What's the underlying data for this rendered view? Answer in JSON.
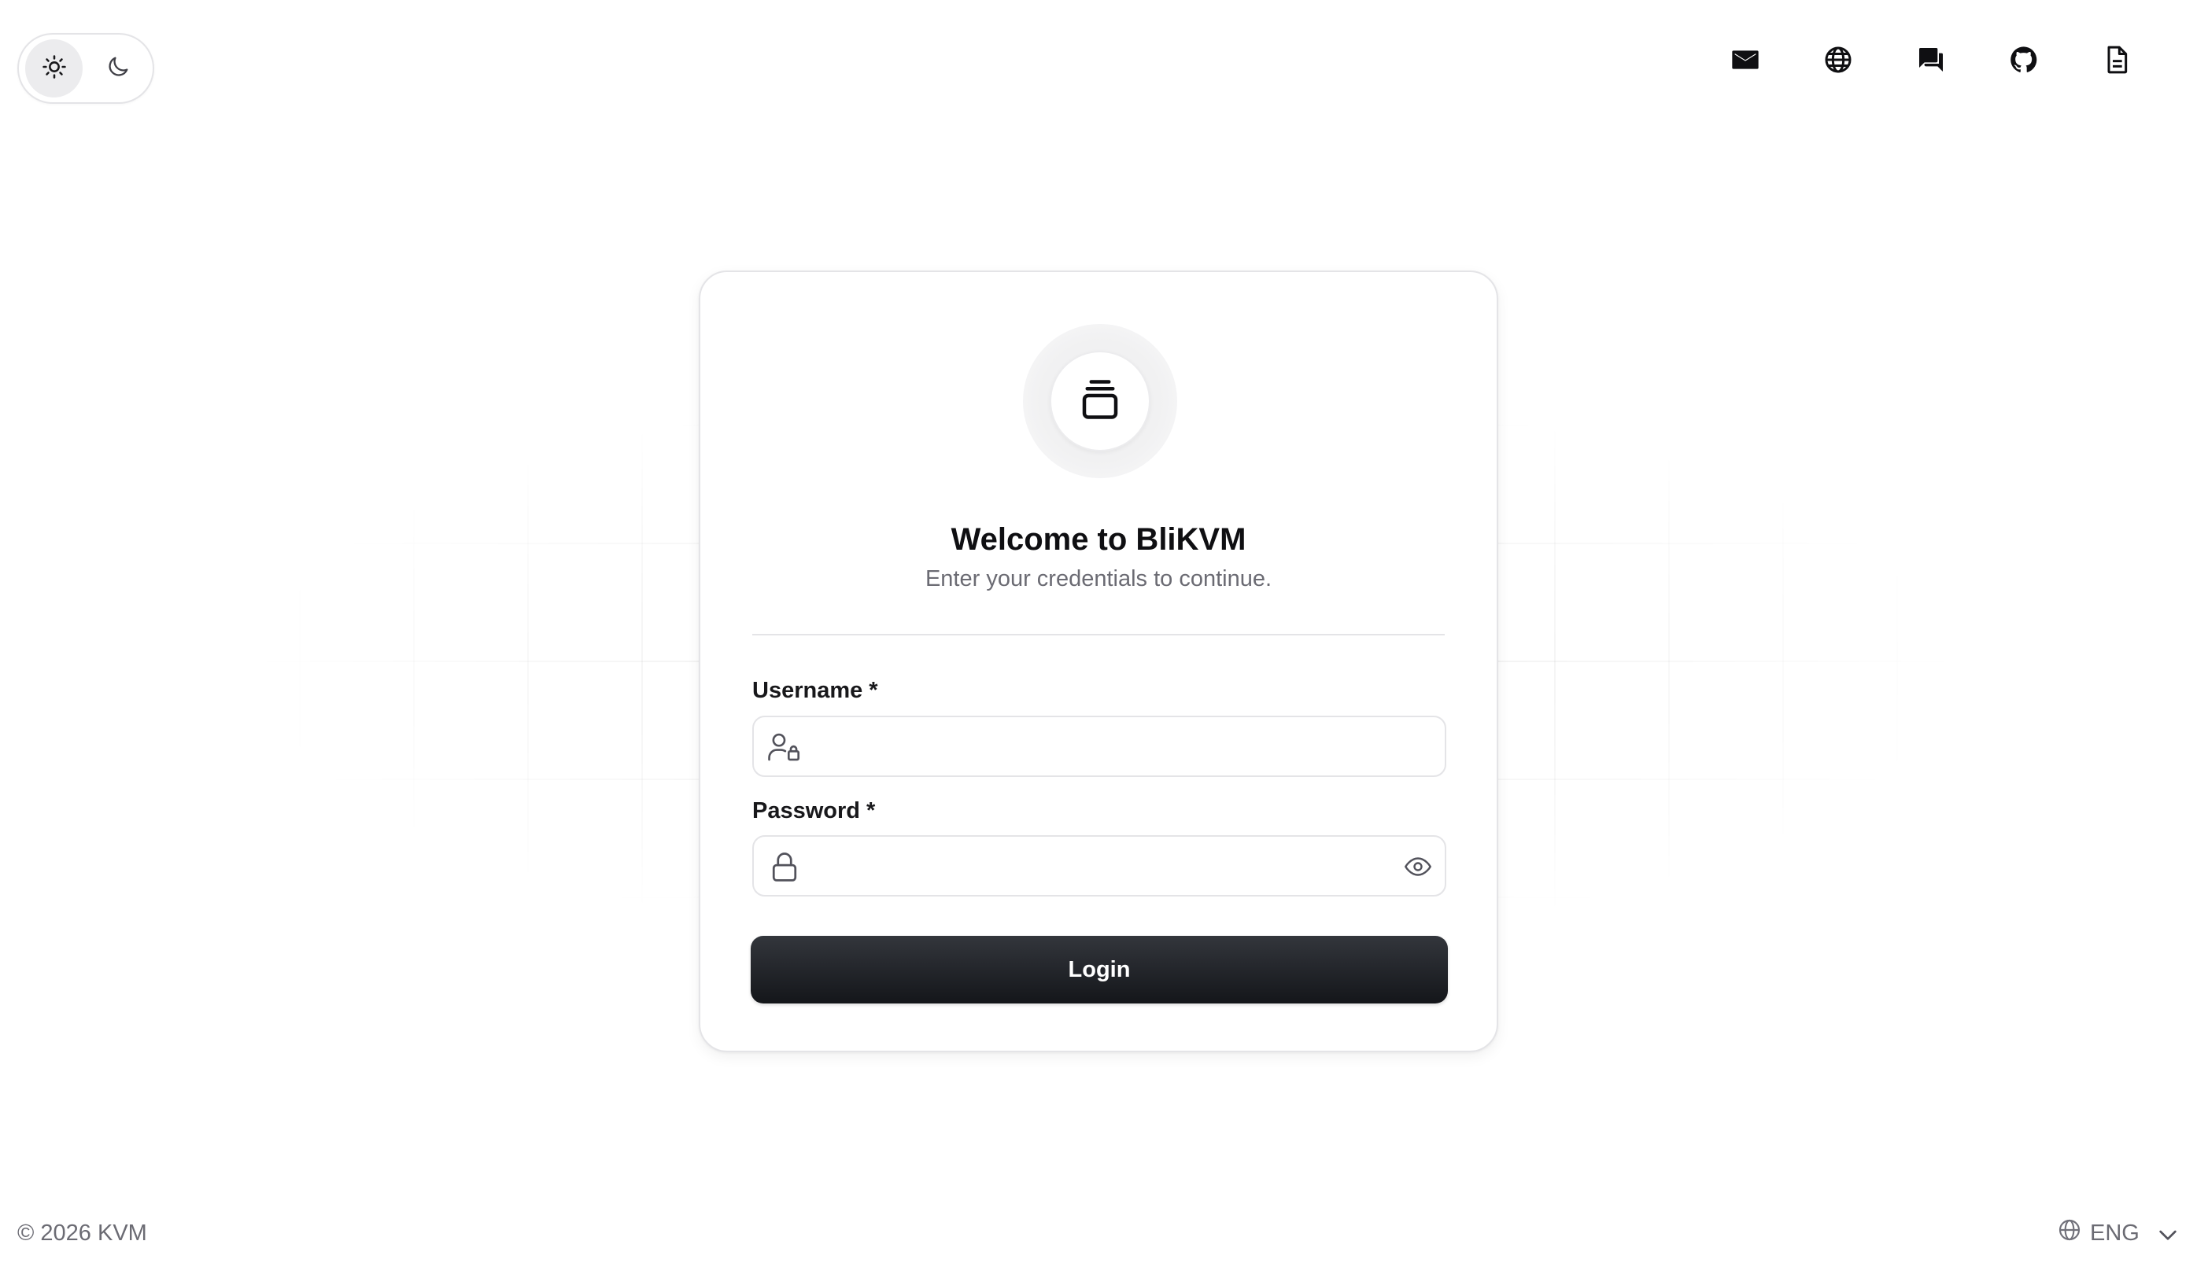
{
  "theme_toggle": {
    "light_icon": "sun-icon",
    "dark_icon": "moon-icon",
    "active": "light"
  },
  "top_nav": {
    "icons": [
      "mail-icon",
      "globe-icon",
      "chat-icon",
      "github-icon",
      "document-icon"
    ]
  },
  "login_card": {
    "logo_icon": "stack-icon",
    "title": "Welcome to BliKVM",
    "subtitle": "Enter your credentials to continue.",
    "username": {
      "label": "Username *",
      "value": "",
      "icon": "user-lock-icon"
    },
    "password": {
      "label": "Password *",
      "value": "",
      "icon": "lock-icon",
      "toggle_icon": "eye-icon"
    },
    "login_button": "Login"
  },
  "footer": {
    "copyright": "© 2026 KVM",
    "language": "ENG",
    "language_icon": "globe-icon"
  },
  "colors": {
    "button_bg": "#1c1e22",
    "muted_text": "#6b6b73",
    "border": "#e4e4e7"
  }
}
